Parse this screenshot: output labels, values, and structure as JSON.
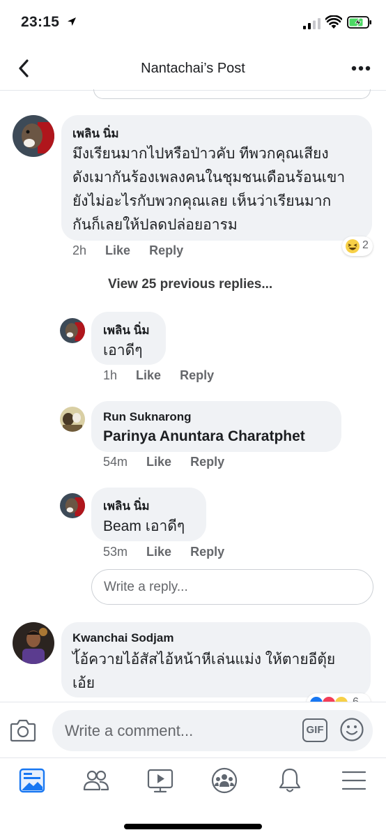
{
  "status_bar": {
    "time": "23:15"
  },
  "header": {
    "title": "Nantachai’s Post"
  },
  "comments": [
    {
      "author": "เพลิน นิ่ม",
      "lines": [
        "มึงเรียนมากไปหรือป่าวคับ ทีพวกคุณเสียง",
        "ดังเมากันร้องเพลงคนในชุมชนเดือนร้อนเขา",
        "ยังไม่อะไรกับพวกคุณเลย เห็นว่าเรียนมาก",
        "กันก็เลยให้ปลดปล่อยอารม"
      ],
      "time": "2h",
      "like": "Like",
      "reply": "Reply",
      "reaction_count": "2"
    },
    {
      "author": "Kwanchai Sodjam",
      "lines": [
        "ไ้อ้ควายไอ้สัสไอ้หน้าหีเล่นแม่ง ให้ตายอีตุ้ย",
        "เอ้ย"
      ],
      "reaction_count": "6"
    }
  ],
  "view_previous": "View 25 previous replies...",
  "replies": [
    {
      "author": "เพลิน นิ่ม",
      "text": "เอาดีๆ",
      "time": "1h",
      "like": "Like",
      "reply": "Reply"
    },
    {
      "author": "Run Suknarong",
      "text": "Parinya Anuntara Charatphet",
      "time": "54m",
      "like": "Like",
      "reply": "Reply"
    },
    {
      "author": "เพลิน นิ่ม",
      "text": "Beam เอาดีๆ",
      "time": "53m",
      "like": "Like",
      "reply": "Reply"
    }
  ],
  "reply_input": {
    "placeholder": "Write a reply..."
  },
  "comment_input": {
    "placeholder": "Write a comment...",
    "gif_label": "GIF"
  },
  "tabs": [
    "news-feed",
    "friends",
    "watch",
    "groups",
    "notifications",
    "menu"
  ],
  "colors": {
    "accent": "#1877f2",
    "bubble": "#f0f2f5",
    "meta": "#65676b"
  }
}
